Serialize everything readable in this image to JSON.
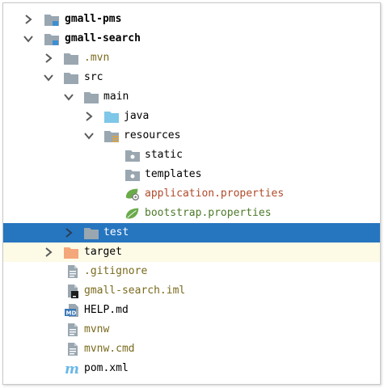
{
  "colors": {
    "selection": "#2675bf",
    "excluded_background": "#fdfbe6",
    "folder_gray": "#9aa7b0",
    "source_folder_blue": "#7ec7e8",
    "excluded_folder_orange": "#f4a77a",
    "spring_green": "#6aab4a"
  },
  "tree": {
    "items": [
      {
        "label": "gmall-pms",
        "icon": "module-folder-icon",
        "arrow": "collapsed"
      },
      {
        "label": "gmall-search",
        "icon": "module-folder-icon",
        "arrow": "expanded"
      },
      {
        "label": ".mvn",
        "icon": "folder-icon",
        "arrow": "collapsed"
      },
      {
        "label": "src",
        "icon": "folder-icon",
        "arrow": "expanded"
      },
      {
        "label": "main",
        "icon": "folder-icon",
        "arrow": "expanded"
      },
      {
        "label": "java",
        "icon": "source-folder-icon",
        "arrow": "collapsed"
      },
      {
        "label": "resources",
        "icon": "resources-folder-icon",
        "arrow": "expanded"
      },
      {
        "label": "static",
        "icon": "folder-dot-icon",
        "arrow": "none"
      },
      {
        "label": "templates",
        "icon": "folder-dot-icon",
        "arrow": "none"
      },
      {
        "label": "application.properties",
        "icon": "spring-config-icon",
        "arrow": "none"
      },
      {
        "label": "bootstrap.properties",
        "icon": "spring-leaf-icon",
        "arrow": "none"
      },
      {
        "label": "test",
        "icon": "folder-icon",
        "arrow": "collapsed",
        "selected": true
      },
      {
        "label": "target",
        "icon": "excluded-folder-icon",
        "arrow": "collapsed"
      },
      {
        "label": ".gitignore",
        "icon": "text-file-icon",
        "arrow": "none"
      },
      {
        "label": "gmall-search.iml",
        "icon": "iml-file-icon",
        "arrow": "none"
      },
      {
        "label": "HELP.md",
        "icon": "markdown-file-icon",
        "arrow": "none"
      },
      {
        "label": "mvnw",
        "icon": "text-file-icon",
        "arrow": "none"
      },
      {
        "label": "mvnw.cmd",
        "icon": "text-file-icon",
        "arrow": "none"
      },
      {
        "label": "pom.xml",
        "icon": "maven-icon",
        "arrow": "none"
      }
    ]
  }
}
